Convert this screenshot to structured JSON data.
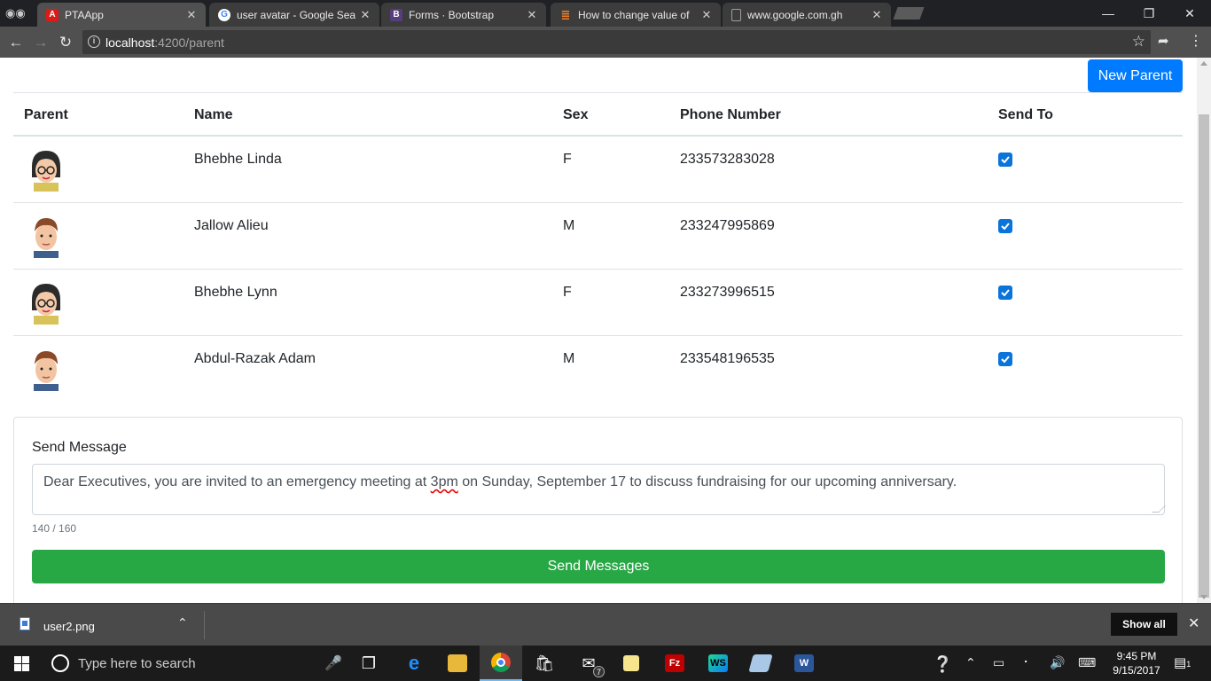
{
  "browser": {
    "tabs": [
      {
        "title": "PTAApp",
        "favicon": "angular-icon",
        "color": "#dd1b16",
        "active": true
      },
      {
        "title": "user avatar - Google Sea",
        "favicon": "google-icon",
        "color": "#4285f4",
        "active": false
      },
      {
        "title": "Forms · Bootstrap",
        "favicon": "bootstrap-icon",
        "color": "#563d7c",
        "active": false
      },
      {
        "title": "How to change value of",
        "favicon": "stackoverflow-icon",
        "color": "#f48024",
        "active": false
      },
      {
        "title": "www.google.com.gh",
        "favicon": "document-icon",
        "color": "#9e9e9e",
        "active": false
      }
    ],
    "address": {
      "host": "localhost",
      "path": ":4200/parent"
    }
  },
  "page": {
    "new_parent_label": "New Parent",
    "table": {
      "headers": [
        "Parent",
        "Name",
        "Sex",
        "Phone Number",
        "Send To"
      ],
      "rows": [
        {
          "avatar": "female-avatar",
          "name": "Bhebhe Linda",
          "sex": "F",
          "phone": "233573283028",
          "send_to": true
        },
        {
          "avatar": "male-avatar",
          "name": "Jallow Alieu",
          "sex": "M",
          "phone": "233247995869",
          "send_to": true
        },
        {
          "avatar": "female-avatar",
          "name": "Bhebhe Lynn",
          "sex": "F",
          "phone": "233273996515",
          "send_to": true
        },
        {
          "avatar": "male-avatar",
          "name": "Abdul-Razak Adam",
          "sex": "M",
          "phone": "233548196535",
          "send_to": true
        }
      ]
    },
    "message": {
      "label": "Send Message",
      "text_before": "Dear Executives, you are invited to an emergency meeting at ",
      "text_misspelled": "3pm",
      "text_after": " on Sunday, September 17 to discuss fundraising for our upcoming anniversary.",
      "counter": "140 / 160",
      "send_label": "Send Messages"
    },
    "colors": {
      "primary": "#007bff",
      "success": "#28a745",
      "checkbox": "#0a74da"
    }
  },
  "downloads": {
    "file": "user2.png",
    "show_all": "Show all"
  },
  "taskbar": {
    "search_placeholder": "Type here to search",
    "mail_badge": "7",
    "notification_badge": "1",
    "time": "9:45 PM",
    "date": "9/15/2017"
  }
}
